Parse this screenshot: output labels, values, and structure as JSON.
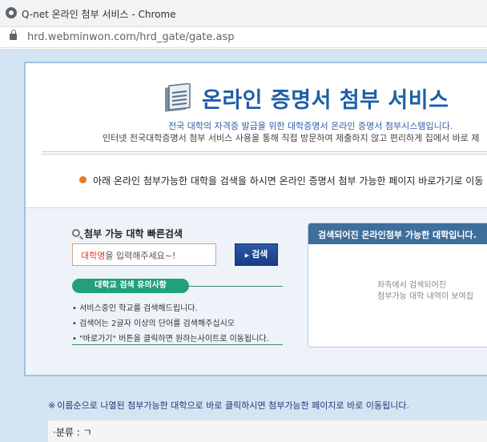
{
  "window": {
    "title": "Q-net 온라인 첨부 서비스 - Chrome",
    "url": "hrd.webminwon.com/hrd_gate/gate.asp"
  },
  "banner": {
    "title": "온라인 증명서 첨부 서비스",
    "subtitle1": "전국 대학의 자격증 발급을 위한 대학증명서 온라인 증명서 첨부시스템입니다.",
    "subtitle2": "인터넷 전국대학증명서 첨부 서비스 사용을 통해 직접 방문하여 제출하지 않고 편리하게 집에서 바로 제",
    "notice": "아래 온라인 첨부가능한 대학을 검색을 하시면 온라인 증명서 첨부 가능한 페이지 바로가기로 이동"
  },
  "search": {
    "heading": "첨부 가능 대학 빠른검색",
    "placeholder_highlight": "대학명",
    "placeholder_rest": "을 입력해주세요~!",
    "button_label": "검색"
  },
  "tips": {
    "title": "대학교 검색 유의사항",
    "items": [
      "서비스중인 학교를 검색해드립니다.",
      "검색어는 2글자 이상의 단어를 검색해주십시오",
      "\"바로가기\" 버튼을 클릭하면 원하는사이트로 이동됩니다."
    ]
  },
  "results": {
    "header": "검색되어진 온라인첨부 가능한 대학입니다.",
    "empty_line1": "좌측에서 검색되어진",
    "empty_line2": "첨부가능 대학 내역이 보여집"
  },
  "bottom": {
    "note_star": "※",
    "note": "이름순으로 나열된 첨부가능한 대학으로 바로 클릭하시면 첨부가능한 페이지로 바로 이동됩니다.",
    "category": "·분류 : ㄱ"
  },
  "colors": {
    "brand_blue": "#1e5fa8",
    "result_header": "#3f6e9b",
    "tips_green": "#22a07a",
    "notice_orange": "#ea7a2a"
  }
}
